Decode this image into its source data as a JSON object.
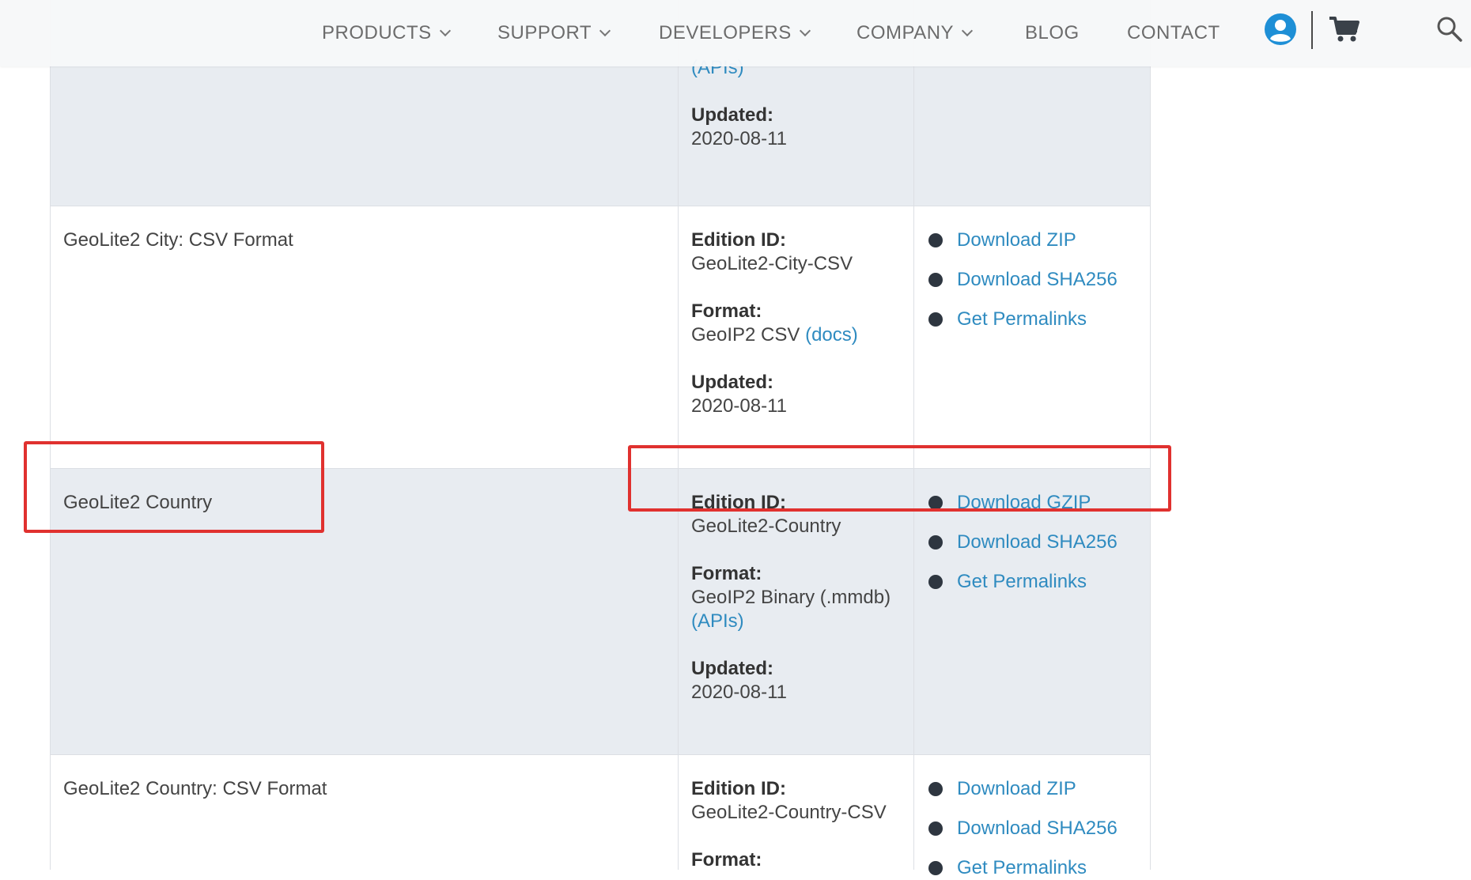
{
  "nav": {
    "items": [
      {
        "label": "PRODUCTS",
        "dropdown": true
      },
      {
        "label": "SUPPORT",
        "dropdown": true
      },
      {
        "label": "DEVELOPERS",
        "dropdown": true
      },
      {
        "label": "COMPANY",
        "dropdown": true
      },
      {
        "label": "BLOG",
        "dropdown": false
      },
      {
        "label": "CONTACT",
        "dropdown": false
      }
    ],
    "icons": [
      "user-icon",
      "cart-icon",
      "search-icon"
    ]
  },
  "colors": {
    "link": "#2f8bc0",
    "row_shade": "#e8ecf1",
    "highlight": "#e0312f",
    "user_icon": "#1e8fd6"
  },
  "rows": [
    {
      "name": "",
      "meta": [
        {
          "label": "",
          "value": "",
          "link": "(APIs)"
        },
        {
          "label": "Updated:",
          "value": "2020-08-11"
        }
      ],
      "links": []
    },
    {
      "name": "GeoLite2 City: CSV Format",
      "meta": [
        {
          "label": "Edition ID:",
          "value": "GeoLite2-City-CSV"
        },
        {
          "label": "Format:",
          "value": "GeoIP2 CSV ",
          "link": "(docs)"
        },
        {
          "label": "Updated:",
          "value": "2020-08-11"
        }
      ],
      "links": [
        "Download ZIP",
        "Download SHA256",
        "Get Permalinks"
      ]
    },
    {
      "name": "GeoLite2 Country",
      "meta": [
        {
          "label": "Edition ID:",
          "value": "GeoLite2-Country"
        },
        {
          "label": "Format:",
          "value": "GeoIP2 Binary (.mmdb)",
          "link": "(APIs)"
        },
        {
          "label": "Updated:",
          "value": "2020-08-11"
        }
      ],
      "links": [
        "Download GZIP",
        "Download SHA256",
        "Get Permalinks"
      ]
    },
    {
      "name": "GeoLite2 Country: CSV Format",
      "meta": [
        {
          "label": "Edition ID:",
          "value": "GeoLite2-Country-CSV"
        },
        {
          "label": "Format:",
          "value": ""
        }
      ],
      "links": [
        "Download ZIP",
        "Download SHA256",
        "Get Permalinks"
      ]
    }
  ]
}
